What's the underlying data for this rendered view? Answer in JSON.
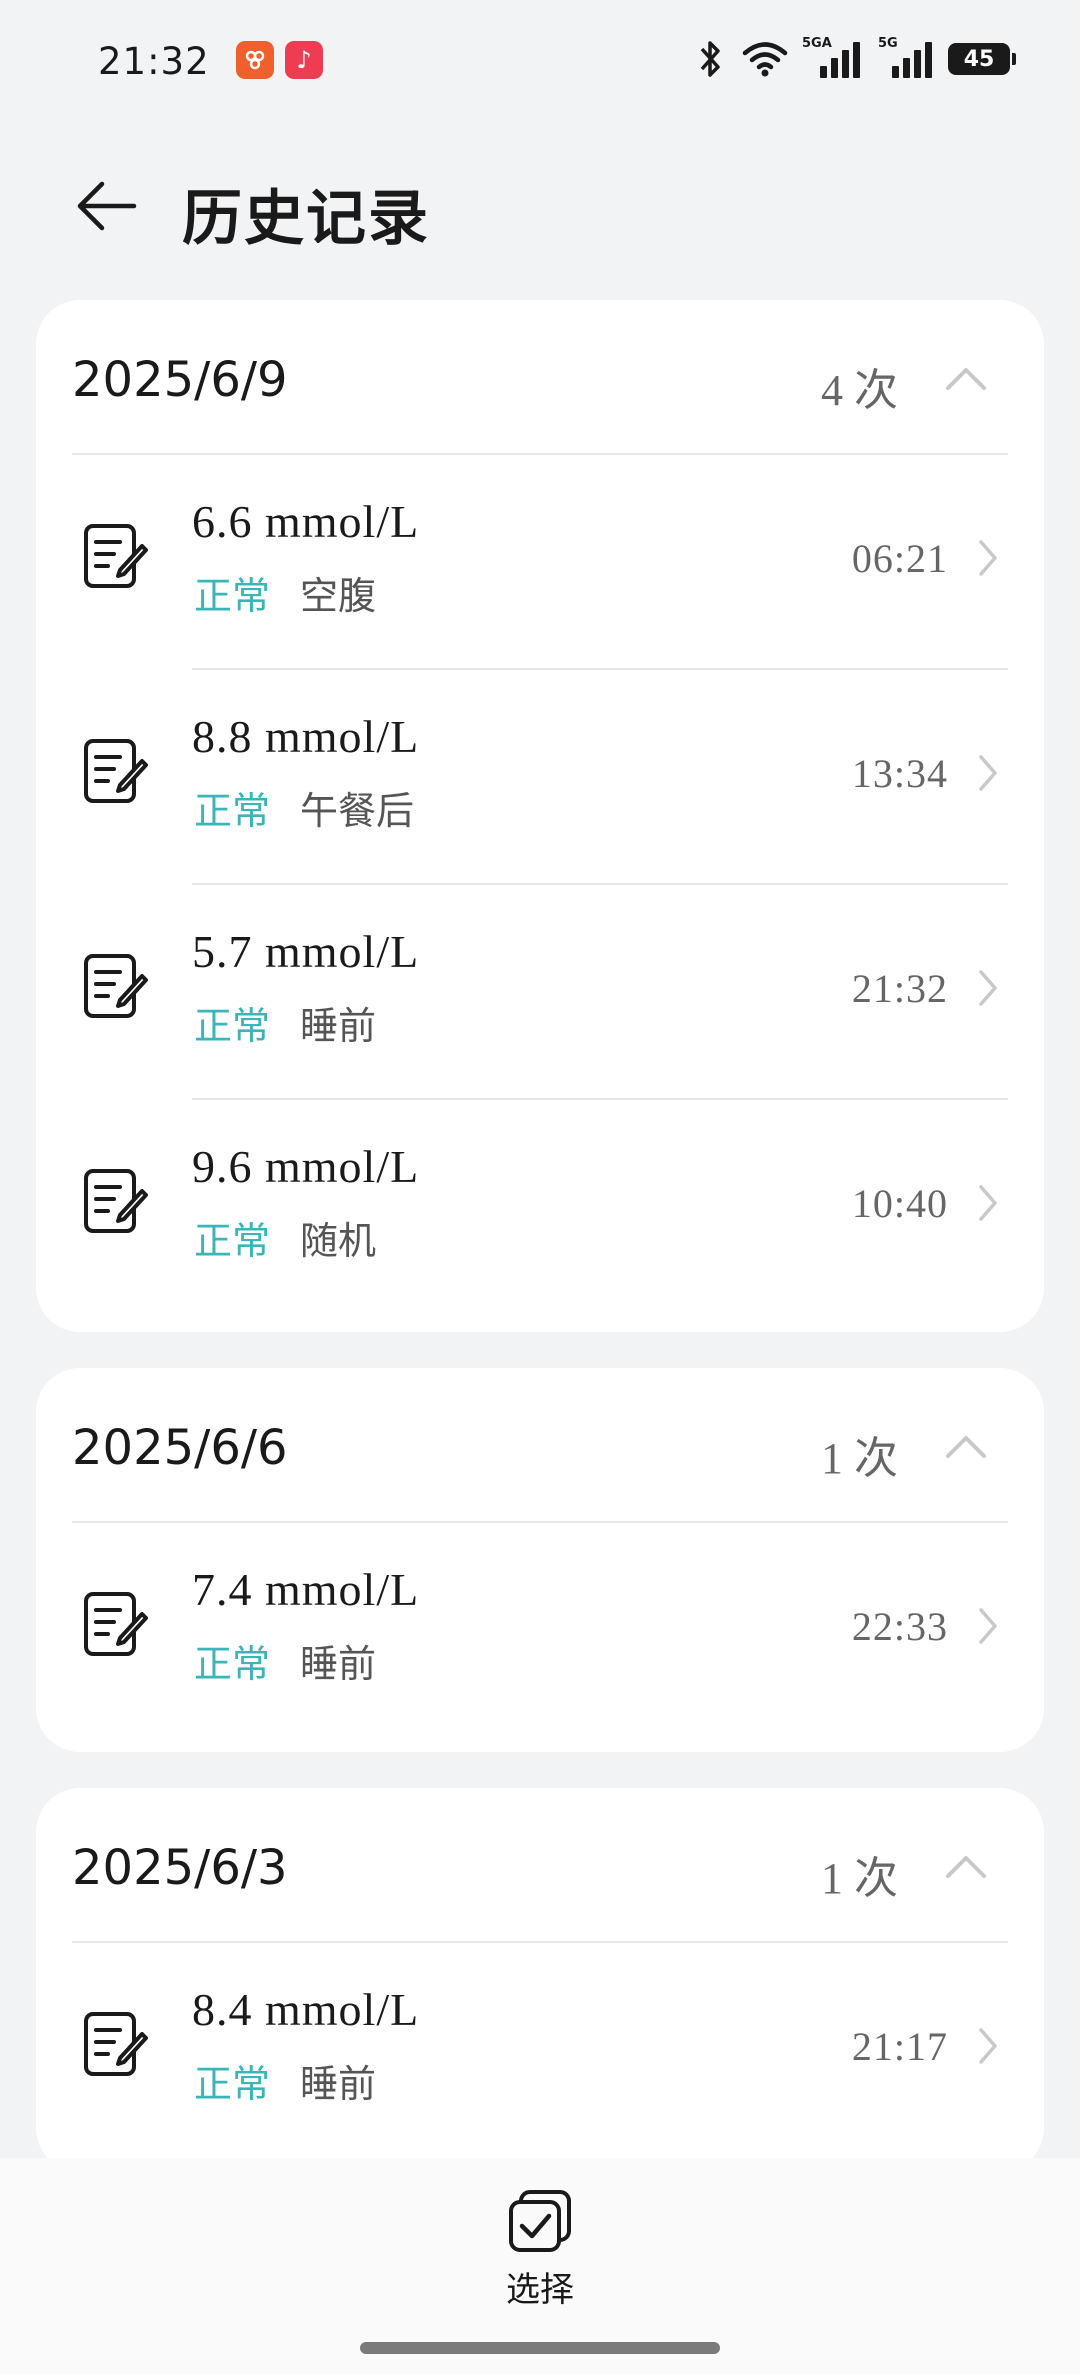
{
  "status_bar": {
    "time": "21:32",
    "battery": "45",
    "signal1_label": "5GA",
    "signal2_label": "5G"
  },
  "header": {
    "title": "历史记录"
  },
  "groups": [
    {
      "date": "2025/6/9",
      "count": "4 次",
      "records": [
        {
          "value": "6.6 mmol/L",
          "status": "正常",
          "period": "空腹",
          "time": "06:21"
        },
        {
          "value": "8.8 mmol/L",
          "status": "正常",
          "period": "午餐后",
          "time": "13:34"
        },
        {
          "value": "5.7 mmol/L",
          "status": "正常",
          "period": "睡前",
          "time": "21:32"
        },
        {
          "value": "9.6 mmol/L",
          "status": "正常",
          "period": "随机",
          "time": "10:40"
        }
      ]
    },
    {
      "date": "2025/6/6",
      "count": "1 次",
      "records": [
        {
          "value": "7.4 mmol/L",
          "status": "正常",
          "period": "睡前",
          "time": "22:33"
        }
      ]
    },
    {
      "date": "2025/6/3",
      "count": "1 次",
      "records": [
        {
          "value": "8.4 mmol/L",
          "status": "正常",
          "period": "睡前",
          "time": "21:17"
        }
      ]
    }
  ],
  "bottom_bar": {
    "select_label": "选择"
  },
  "colors": {
    "accent": "#3ab6b8",
    "background": "#f1f3f5",
    "card": "#ffffff"
  }
}
